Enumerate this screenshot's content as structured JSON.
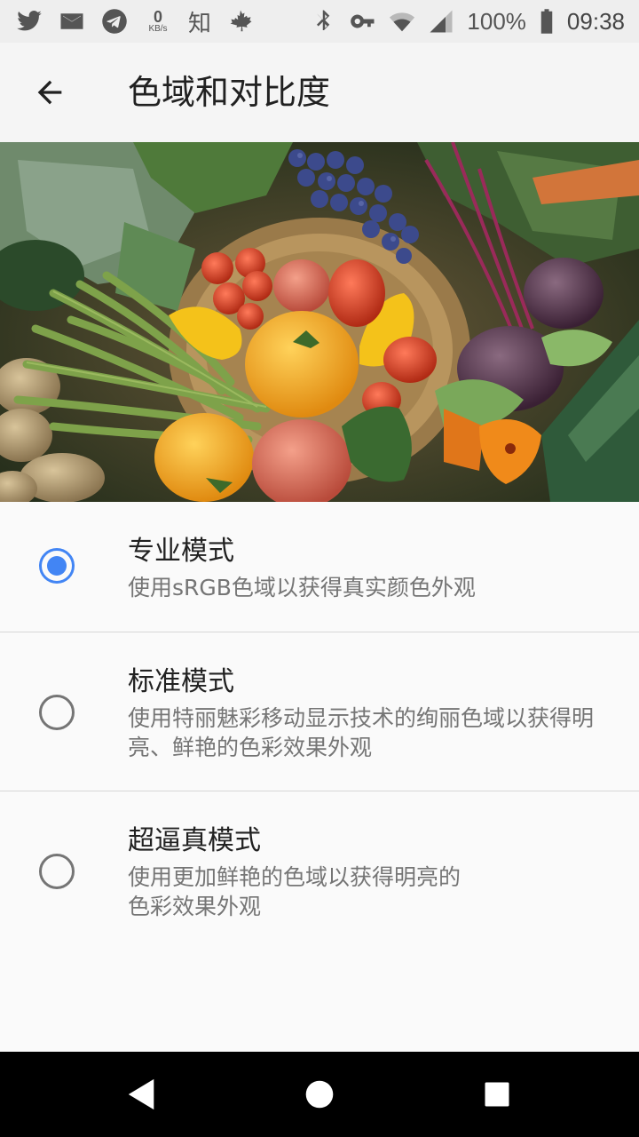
{
  "status_bar": {
    "net_speed_value": "0",
    "net_speed_unit": "KB/s",
    "zhihu_label": "知",
    "battery_text": "100%",
    "time": "09:38"
  },
  "app_bar": {
    "title": "色域和对比度"
  },
  "options": [
    {
      "title": "专业模式",
      "description": "使用sRGB色域以获得真实颜色外观",
      "selected": true
    },
    {
      "title": "标准模式",
      "description": "使用特丽魅彩移动显示技术的绚丽色域以获得明亮、鲜艳的色彩效果外观",
      "selected": false
    },
    {
      "title": "超逼真模式",
      "description": "使用更加鲜艳的色域以获得明亮的\n色彩效果外观",
      "selected": false
    }
  ],
  "colors": {
    "accent": "#4285f4",
    "status_bar_bg": "#eeeeee",
    "nav_bar_bg": "#000000"
  }
}
